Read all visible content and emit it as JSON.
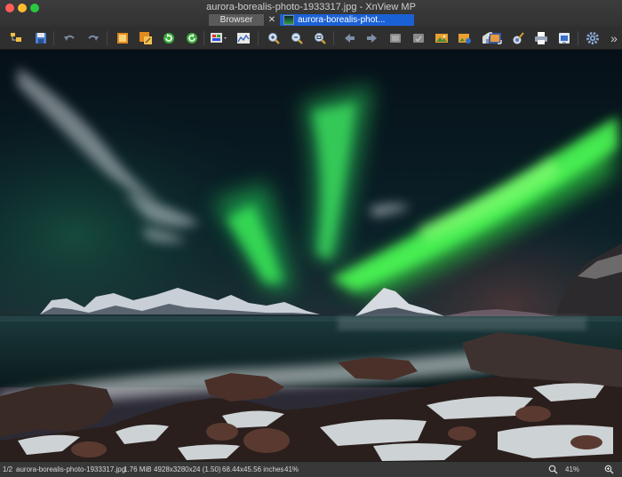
{
  "window": {
    "title": "aurora-borealis-photo-1933317.jpg - XnView MP"
  },
  "tabs": {
    "browser_label": "Browser",
    "close_glyph": "✕",
    "photo_label": "aurora-borealis-phot..."
  },
  "toolbar": {
    "icons": [
      "browse-folder-icon",
      "save-icon",
      "undo-icon",
      "redo-icon",
      "crop-icon",
      "resize-icon",
      "rotate-left-icon",
      "rotate-right-icon",
      "adjust-colors-icon",
      "histogram-icon",
      "zoom-in-icon",
      "zoom-out-icon",
      "zoom-fit-icon",
      "previous-icon",
      "next-icon",
      "fullscreen-icon",
      "slideshow-icon",
      "set-wallpaper-icon",
      "print-icon",
      "settings-icon",
      "more-icon"
    ],
    "more_glyph": "»"
  },
  "status": {
    "position": "1/2",
    "filename": "aurora-borealis-photo-1933317.jpg",
    "filesize": "1.76 MiB",
    "dimensions": "4928x3280x24 (1.50)",
    "print_size": "68.44x45.56 inches",
    "zoom": "41%",
    "zoom_right": "41%"
  },
  "colors": {
    "accent": "#1b61d6",
    "aurora": "#39ff4a",
    "sky": "#07121c"
  }
}
